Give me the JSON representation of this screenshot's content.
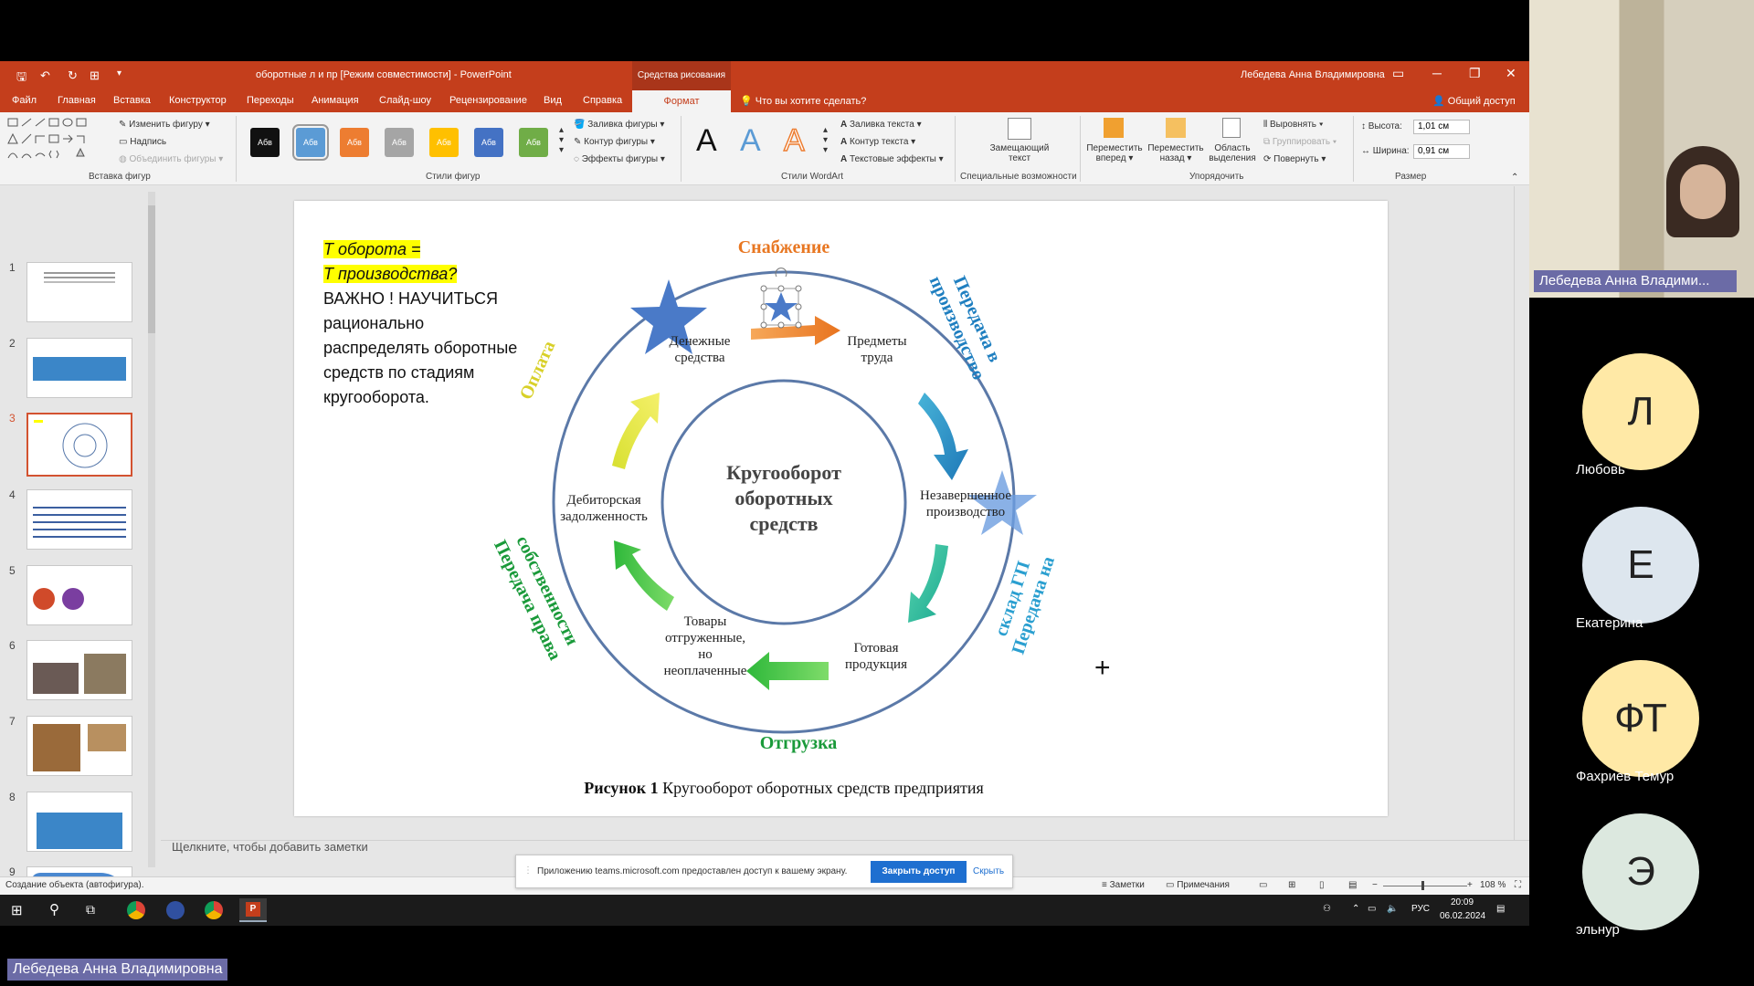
{
  "window": {
    "title": "оборотные л и пр [Режим совместимости] - PowerPoint",
    "context_tab": "Средства рисования",
    "user": "Лебедева Анна Владимировна",
    "tell_me": "Что вы хотите сделать?",
    "share": "Общий доступ"
  },
  "tabs": [
    "Файл",
    "Главная",
    "Вставка",
    "Конструктор",
    "Переходы",
    "Анимация",
    "Слайд-шоу",
    "Рецензирование",
    "Вид",
    "Справка"
  ],
  "active_tab": "Формат",
  "ribbon": {
    "groups": {
      "insert_shapes": "Вставка фигур",
      "shape_styles": "Стили фигур",
      "wordart_styles": "Стили WordArt",
      "accessibility": "Специальные возможности",
      "arrange": "Упорядочить",
      "size": "Размер"
    },
    "edit_shape": "Изменить фигуру",
    "text_box": "Надпись",
    "merge_shapes": "Объединить фигуры",
    "style_sample": "Абв",
    "style_colors": [
      "#111111",
      "#5b9bd5",
      "#ed7d31",
      "#a5a5a5",
      "#ffc000",
      "#4472c4",
      "#70ad47"
    ],
    "shape_fill": "Заливка фигуры",
    "shape_outline": "Контур фигуры",
    "shape_effects": "Эффекты фигуры",
    "wordart_letter": "A",
    "text_fill": "Заливка текста",
    "text_outline": "Контур текста",
    "text_effects": "Текстовые эффекты",
    "alt_text_1": "Замещающий",
    "alt_text_2": "текст",
    "bring_forward_1": "Переместить",
    "bring_forward_2": "вперед",
    "send_backward_1": "Переместить",
    "send_backward_2": "назад",
    "selection_pane_1": "Область",
    "selection_pane_2": "выделения",
    "align": "Выровнять",
    "group": "Группировать",
    "rotate": "Повернуть",
    "height_label": "Высота:",
    "height_value": "1,01 см",
    "width_label": "Ширина:",
    "width_value": "0,91 см"
  },
  "thumbnails": [
    "1",
    "2",
    "3",
    "4",
    "5",
    "6",
    "7",
    "8",
    "9"
  ],
  "selected_slide": "3",
  "slide": {
    "highlight_1": "Т оборота =",
    "highlight_2": "Т производства?",
    "body": "ВАЖНО ! НАУЧИТЬСЯ рационально распределять оборотные средств по стадиям кругооборота.",
    "center_1": "Кругооборот",
    "center_2": "оборотных",
    "center_3": "средств",
    "node_money_1": "Денежные",
    "node_money_2": "средства",
    "node_labor_1": "Предметы",
    "node_labor_2": "труда",
    "node_wip_1": "Незавершенное",
    "node_wip_2": "производство",
    "node_finished_1": "Готовая",
    "node_finished_2": "продукция",
    "node_shipped_1": "Товары",
    "node_shipped_2": "отгруженные,",
    "node_shipped_3": "но",
    "node_shipped_4": "неоплаченные",
    "node_receivable_1": "Дебиторская",
    "node_receivable_2": "задолженность",
    "outer_supply": "Снабжение",
    "outer_production_1": "Передача в",
    "outer_production_2": "производство",
    "outer_warehouse_1": "Передача на",
    "outer_warehouse_2": "склад ГП",
    "outer_shipment": "Отгрузка",
    "outer_ownership_1": "Передача права",
    "outer_ownership_2": "собственности",
    "outer_payment": "Оплата",
    "caption_bold": "Рисунок 1",
    "caption_rest": " Кругооборот оборотных средств предприятия"
  },
  "notes_placeholder": "Щелкните, чтобы добавить заметки",
  "status": {
    "left": "Создание объекта (автофигура).",
    "notes": "Заметки",
    "comments": "Примечания",
    "zoom": "108 %"
  },
  "notification": {
    "text": "Приложению teams.microsoft.com предоставлен доступ к вашему экрану.",
    "stop": "Закрыть доступ",
    "hide": "Скрыть"
  },
  "taskbar": {
    "lang": "РУС",
    "time": "20:09",
    "date": "06.02.2024"
  },
  "participants": [
    {
      "initials": "Л",
      "name": "Любовь",
      "color": "#ffe9a6"
    },
    {
      "initials": "Е",
      "name": "Екатерина",
      "color": "#dde6ee"
    },
    {
      "initials": "ФТ",
      "name": "Фахриев Темур",
      "color": "#ffe9a6"
    },
    {
      "initials": "Э",
      "name": "эльнур",
      "color": "#dce8df"
    }
  ],
  "presenter_label": "Лебедева Анна Владими...",
  "presenter_full": "Лебедева Анна Владимировна"
}
